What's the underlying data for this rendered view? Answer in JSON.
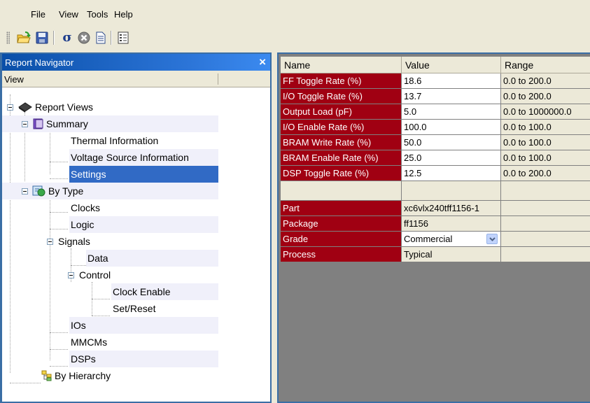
{
  "menubar": {
    "items": [
      "File",
      "View",
      "Tools",
      "Help"
    ]
  },
  "toolbar": {
    "buttons": [
      "open-folder-icon",
      "save-icon",
      "sigma-icon",
      "stop-icon",
      "document-icon",
      "properties-icon"
    ]
  },
  "navigator": {
    "title": "Report Navigator",
    "close_label": "×",
    "column_header": "View",
    "tree": {
      "report_views": "Report Views",
      "summary": "Summary",
      "thermal": "Thermal Information",
      "voltage": "Voltage Source Information",
      "settings": "Settings",
      "by_type": "By Type",
      "clocks": "Clocks",
      "logic": "Logic",
      "signals": "Signals",
      "data": "Data",
      "control": "Control",
      "clock_enable": "Clock Enable",
      "set_reset": "Set/Reset",
      "ios": "IOs",
      "mmcms": "MMCMs",
      "dsps": "DSPs",
      "by_hierarchy": "By Hierarchy"
    }
  },
  "grid": {
    "headers": [
      "Name",
      "Value",
      "Range"
    ],
    "rows": [
      {
        "name": "FF Toggle Rate (%)",
        "value": "18.6",
        "range": "0.0 to 200.0"
      },
      {
        "name": "I/O Toggle Rate (%)",
        "value": "13.7",
        "range": "0.0 to 200.0"
      },
      {
        "name": "Output Load (pF)",
        "value": "5.0",
        "range": "0.0 to 1000000.0"
      },
      {
        "name": "I/O Enable Rate (%)",
        "value": "100.0",
        "range": "0.0 to 100.0"
      },
      {
        "name": "BRAM Write Rate (%)",
        "value": "50.0",
        "range": "0.0 to 100.0"
      },
      {
        "name": "BRAM Enable Rate (%)",
        "value": "25.0",
        "range": "0.0 to 100.0"
      },
      {
        "name": "DSP Toggle Rate (%)",
        "value": "12.5",
        "range": "0.0 to 200.0"
      }
    ],
    "device": {
      "part_label": "Part",
      "part_value": "xc6vlx240tff1156-1",
      "package_label": "Package",
      "package_value": "ff1156",
      "grade_label": "Grade",
      "grade_value": "Commercial",
      "process_label": "Process",
      "process_value": "Typical"
    }
  },
  "colors": {
    "title_bar": "#0a4fa8",
    "selection": "#316ac5",
    "name_cell": "#a00012",
    "window_bg": "#ece9d8"
  }
}
